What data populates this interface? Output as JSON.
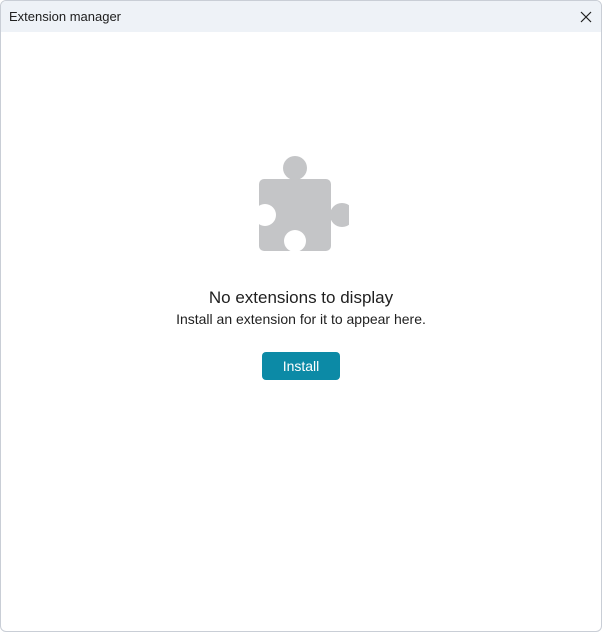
{
  "window": {
    "title": "Extension manager",
    "close_icon": "close-icon"
  },
  "empty_state": {
    "icon": "puzzle-piece-icon",
    "title": "No extensions to display",
    "subtitle": "Install an extension for it to appear here.",
    "install_label": "Install"
  },
  "colors": {
    "titlebar_bg": "#eef2f7",
    "accent": "#0c8aa6",
    "icon_gray": "#c4c5c7"
  }
}
